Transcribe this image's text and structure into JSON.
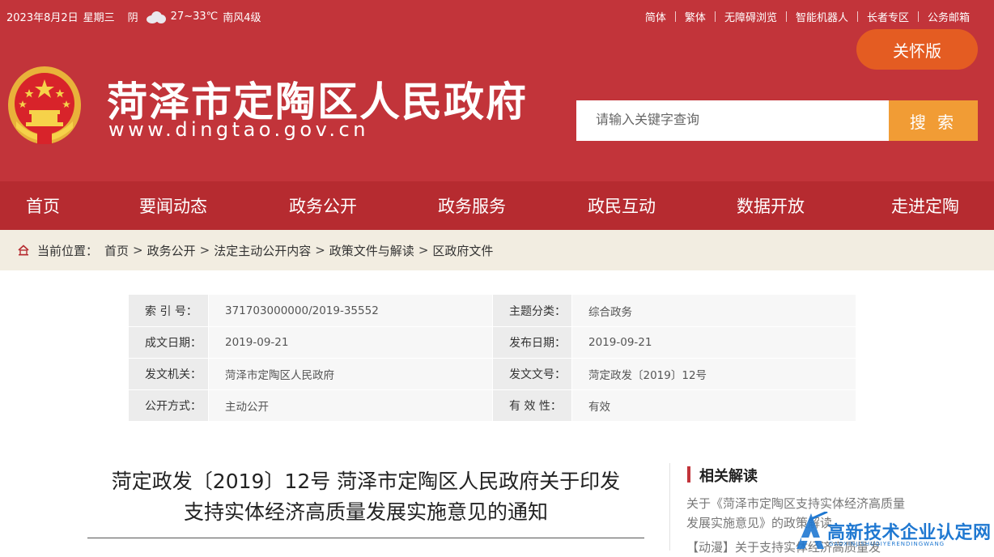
{
  "topbar": {
    "date": "2023年8月2日",
    "weekday": "星期三",
    "weather": "阴",
    "temperature": "27~33℃",
    "wind": "南风4级",
    "links": [
      "简体",
      "繁体",
      "无障碍浏览",
      "智能机器人",
      "长者专区",
      "公务邮箱"
    ]
  },
  "header": {
    "care_label": "关怀版",
    "site_title": "菏泽市定陶区人民政府",
    "site_url": "www.dingtao.gov.cn",
    "search_placeholder": "请输入关键字查询",
    "search_label": "搜 索"
  },
  "nav": {
    "items": [
      "首页",
      "要闻动态",
      "政务公开",
      "政务服务",
      "政民互动",
      "数据开放",
      "走进定陶"
    ]
  },
  "breadcrumb": {
    "label": "当前位置：",
    "items": [
      "首页",
      "政务公开",
      "法定主动公开内容",
      "政策文件与解读",
      "区政府文件"
    ],
    "arrow": ">"
  },
  "meta": {
    "rows": [
      [
        {
          "label": "索 引 号：",
          "value": "371703000000/2019-35552"
        },
        {
          "label": "主题分类：",
          "value": "综合政务"
        }
      ],
      [
        {
          "label": "成文日期：",
          "value": "2019-09-21"
        },
        {
          "label": "发布日期：",
          "value": "2019-09-21"
        }
      ],
      [
        {
          "label": "发文机关：",
          "value": "菏泽市定陶区人民政府"
        },
        {
          "label": "发文文号：",
          "value": "菏定政发〔2019〕12号"
        }
      ],
      [
        {
          "label": "公开方式：",
          "value": "主动公开"
        },
        {
          "label": "有 效 性：",
          "value": "有效"
        }
      ]
    ]
  },
  "article": {
    "title_line1": "菏定政发〔2019〕12号 菏泽市定陶区人民政府关于印发",
    "title_line2": "支持实体经济高质量发展实施意见的通知"
  },
  "sidebar": {
    "title": "相关解读",
    "link1": "关于《菏泽市定陶区支持实体经济高质量发展实施意见》的政策解读",
    "link2": "【动漫】关于支持实体经济高质量发"
  },
  "watermark": {
    "text": "高新技术企业认定网",
    "sub": "GAOXINJISHUQIYERENDINGWANG"
  },
  "colors": {
    "header_red": "#c2343a",
    "nav_red": "#b62b30",
    "care_orange": "#e45c22",
    "search_orange": "#f19c35",
    "breadcrumb_bg": "#f2ede1"
  }
}
